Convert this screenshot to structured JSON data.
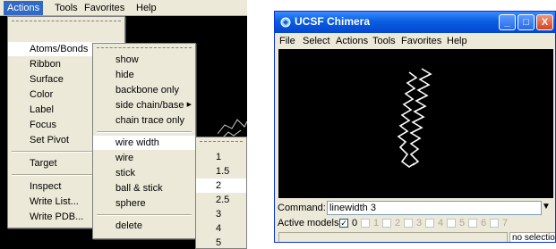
{
  "left_menubar": {
    "items": [
      "Actions",
      "Tools",
      "Favorites",
      "Help"
    ]
  },
  "actions_menu": {
    "items": [
      "Atoms/Bonds",
      "Ribbon",
      "Surface",
      "Color",
      "Label",
      "Focus",
      "Set Pivot",
      "Target",
      "Inspect",
      "Write List...",
      "Write PDB..."
    ],
    "highlighted": "Atoms/Bonds"
  },
  "atoms_bonds_menu": {
    "items": [
      "show",
      "hide",
      "backbone only",
      "side chain/base",
      "chain trace only",
      "wire width",
      "wire",
      "stick",
      "ball & stick",
      "sphere",
      "delete"
    ],
    "highlighted": "wire width"
  },
  "wire_width_menu": {
    "items": [
      "1",
      "1.5",
      "2",
      "2.5",
      "3",
      "4",
      "5"
    ],
    "highlighted": "2"
  },
  "window": {
    "title": "UCSF Chimera",
    "min_glyph": "_",
    "max_glyph": "□",
    "close_glyph": "X",
    "menu": [
      "File",
      "Select",
      "Actions",
      "Tools",
      "Favorites",
      "Help"
    ],
    "command_label": "Command:",
    "command_value": "linewidth 3",
    "command_dropdown_glyph": "▼",
    "models_label": "Active models:",
    "models": [
      {
        "id": "0",
        "checked": true
      },
      {
        "id": "1",
        "checked": false
      },
      {
        "id": "2",
        "checked": false
      },
      {
        "id": "3",
        "checked": false
      },
      {
        "id": "4",
        "checked": false
      },
      {
        "id": "5",
        "checked": false
      },
      {
        "id": "6",
        "checked": false
      },
      {
        "id": "7",
        "checked": false
      }
    ],
    "check_glyph": "✓",
    "status_right": "no selection"
  },
  "colors": {
    "menu_bg": "#ece9d8",
    "active_menu": "#316ac5",
    "titlebar": "#0a5ee0",
    "viewport": "#000000"
  }
}
